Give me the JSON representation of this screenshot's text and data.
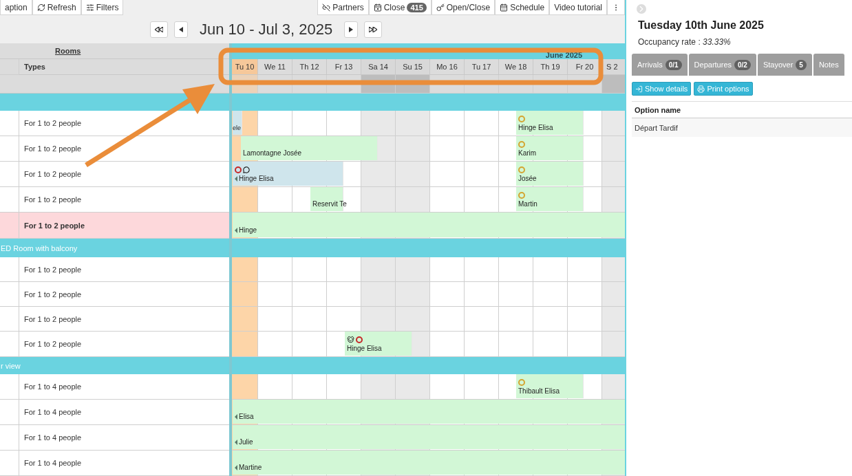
{
  "toolbar": {
    "left": [
      {
        "label": "aption"
      },
      {
        "label": "Refresh"
      },
      {
        "label": "Filters"
      }
    ],
    "right": [
      {
        "label": "Partners"
      },
      {
        "label": "Close",
        "badge": "415"
      },
      {
        "label": "Open/Close"
      },
      {
        "label": "Schedule"
      },
      {
        "label": "Video tutorial"
      }
    ]
  },
  "navigator": {
    "title": "Jun 10 - Jul 3, 2025"
  },
  "planning": {
    "rooms_header": "Rooms",
    "types_header": "Types",
    "month": "June 2025",
    "days": [
      {
        "label": "Tu 10",
        "today": true,
        "weekend": false
      },
      {
        "label": "We 11",
        "today": false,
        "weekend": false
      },
      {
        "label": "Th 12",
        "today": false,
        "weekend": false
      },
      {
        "label": "Fr 13",
        "today": false,
        "weekend": false
      },
      {
        "label": "Sa 14",
        "today": false,
        "weekend": true
      },
      {
        "label": "Su 15",
        "today": false,
        "weekend": true
      },
      {
        "label": "Mo 16",
        "today": false,
        "weekend": false
      },
      {
        "label": "Tu 17",
        "today": false,
        "weekend": false
      },
      {
        "label": "We 18",
        "today": false,
        "weekend": false
      },
      {
        "label": "Th 19",
        "today": false,
        "weekend": false
      },
      {
        "label": "Fr 20",
        "today": false,
        "weekend": false
      },
      {
        "label": "S 2",
        "today": false,
        "weekend": true
      }
    ],
    "sections": [
      {
        "rooms": [
          {
            "type": "For 1 to 2 people",
            "highlighted": false,
            "bookings": [
              {
                "guest": "ele",
                "color": "#cfe5ec",
                "continues_before": false
              },
              {
                "guest": "Hinge Elisa",
                "color": "#d2f7d6",
                "continues_before": false,
                "markers": [
                  {
                    "kind": "circle",
                    "color": "#d4a531"
                  }
                ]
              }
            ]
          },
          {
            "type": "For 1 to 2 people",
            "highlighted": false,
            "bookings": [
              {
                "guest": "Lamontagne Josée",
                "color": "#d2f7d6",
                "continues_before": false
              },
              {
                "guest": "Karim",
                "color": "#d2f7d6",
                "continues_before": false,
                "markers": [
                  {
                    "kind": "circle",
                    "color": "#d4a531"
                  }
                ]
              }
            ]
          },
          {
            "type": "For 1 to 2 people",
            "highlighted": false,
            "bookings": [
              {
                "guest": "Hinge Elisa",
                "color": "#cfe5ec",
                "continues_before": true,
                "markers": [
                  {
                    "kind": "circle",
                    "color": "#c62828"
                  },
                  {
                    "kind": "message"
                  }
                ]
              },
              {
                "guest": "Josée",
                "color": "#d2f7d6",
                "continues_before": false,
                "markers": [
                  {
                    "kind": "circle",
                    "color": "#d4a531"
                  }
                ]
              }
            ]
          },
          {
            "type": "For 1 to 2 people",
            "highlighted": false,
            "bookings": [
              {
                "guest": "Reservit Te",
                "color": "#d2f7d6",
                "continues_before": false
              },
              {
                "guest": "Martin",
                "color": "#d2f7d6",
                "continues_before": false,
                "markers": [
                  {
                    "kind": "circle",
                    "color": "#d4a531"
                  }
                ]
              }
            ]
          },
          {
            "type": "For 1 to 2 people",
            "highlighted": true,
            "bookings": [
              {
                "guest": "Hinge",
                "color": "#d2f7d6",
                "continues_before": true
              }
            ]
          }
        ]
      },
      {
        "label": "ED Room with balcony",
        "rooms": [
          {
            "type": "For 1 to 2 people",
            "highlighted": false
          },
          {
            "type": "For 1 to 2 people",
            "highlighted": false
          },
          {
            "type": "For 1 to 2 people",
            "highlighted": false
          },
          {
            "type": "For 1 to 2 people",
            "highlighted": false,
            "bookings": [
              {
                "guest": "Hinge Elisa",
                "color": "#d2f7d6",
                "continues_before": false,
                "markers": [
                  {
                    "kind": "pet"
                  },
                  {
                    "kind": "circle",
                    "color": "#c62828"
                  }
                ]
              }
            ]
          }
        ]
      },
      {
        "label": "r view",
        "rooms": [
          {
            "type": "For 1 to 4 people",
            "highlighted": false,
            "bookings": [
              {
                "guest": "Thibault Elisa",
                "color": "#d2f7d6",
                "continues_before": false,
                "markers": [
                  {
                    "kind": "circle",
                    "color": "#d4a531"
                  }
                ]
              }
            ]
          },
          {
            "type": "For 1 to 4 people",
            "highlighted": false,
            "bookings": [
              {
                "guest": "Elisa",
                "color": "#d2f7d6",
                "continues_before": true
              }
            ]
          },
          {
            "type": "For 1 to 4 people",
            "highlighted": false,
            "bookings": [
              {
                "guest": "Julie",
                "color": "#d2f7d6",
                "continues_before": true
              }
            ]
          },
          {
            "type": "For 1 to 4 people",
            "highlighted": false,
            "bookings": [
              {
                "guest": "Martine",
                "color": "#d2f7d6",
                "continues_before": true
              }
            ]
          }
        ]
      }
    ]
  },
  "day_panel": {
    "title": "Tuesday 10th June 2025",
    "occupancy": "Occupancy rate : *33.33%*",
    "tabs": [
      {
        "label": "Arrivals",
        "badge": "0/1"
      },
      {
        "label": "Departures",
        "badge": "0/2"
      },
      {
        "label": "Stayover",
        "badge": "5"
      },
      {
        "label": "Notes"
      }
    ],
    "buttons": [
      {
        "label": "Show details"
      },
      {
        "label": "Print options"
      }
    ],
    "table": {
      "columns": [
        "Option name"
      ],
      "rows": [
        [
          "Départ Tardif"
        ]
      ]
    }
  }
}
